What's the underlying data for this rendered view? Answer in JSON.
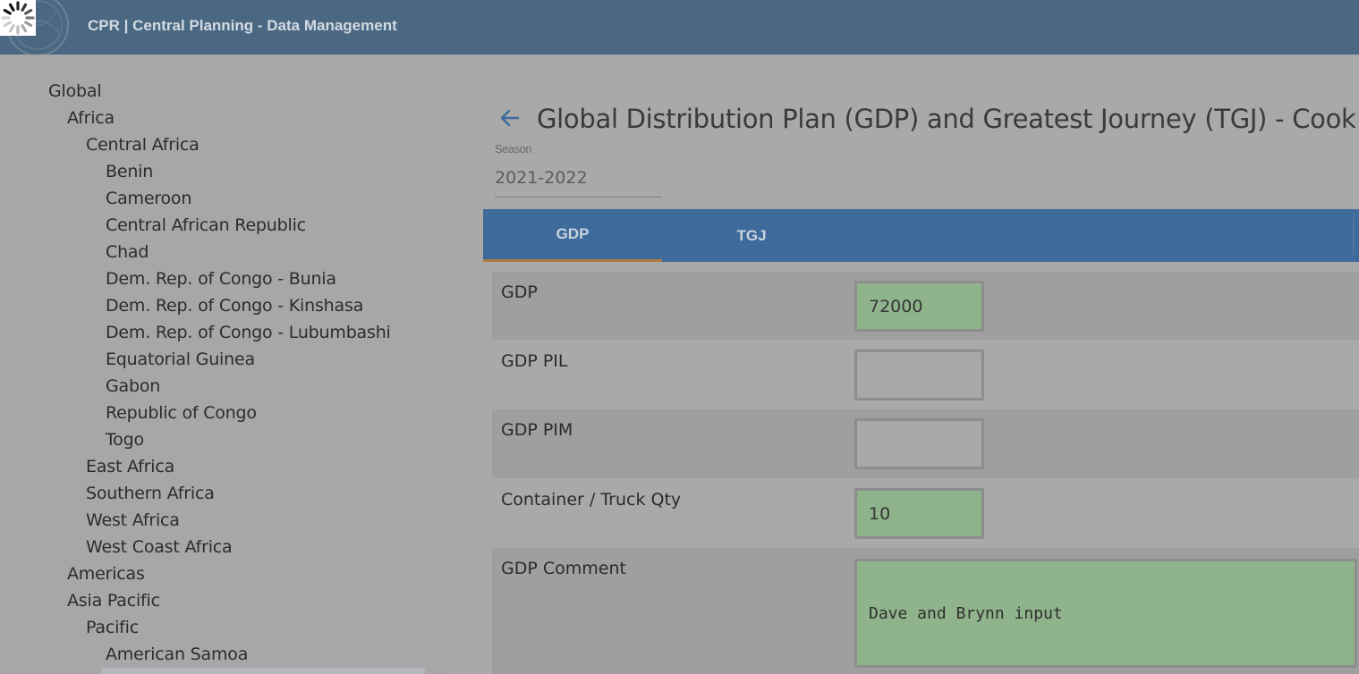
{
  "header": {
    "title": "CPR | Central Planning - Data Management"
  },
  "sidebar": {
    "items": [
      {
        "label": "Global",
        "level": 0
      },
      {
        "label": "Africa",
        "level": 1
      },
      {
        "label": "Central Africa",
        "level": 2
      },
      {
        "label": "Benin",
        "level": 3
      },
      {
        "label": "Cameroon",
        "level": 3
      },
      {
        "label": "Central African Republic",
        "level": 3
      },
      {
        "label": "Chad",
        "level": 3
      },
      {
        "label": "Dem. Rep. of Congo - Bunia",
        "level": 3
      },
      {
        "label": "Dem. Rep. of Congo - Kinshasa",
        "level": 3
      },
      {
        "label": "Dem. Rep. of Congo - Lubumbashi",
        "level": 3
      },
      {
        "label": "Equatorial Guinea",
        "level": 3
      },
      {
        "label": "Gabon",
        "level": 3
      },
      {
        "label": "Republic of Congo",
        "level": 3
      },
      {
        "label": "Togo",
        "level": 3
      },
      {
        "label": "East Africa",
        "level": 2
      },
      {
        "label": "Southern Africa",
        "level": 2
      },
      {
        "label": "West Africa",
        "level": 2
      },
      {
        "label": "West Coast Africa",
        "level": 2
      },
      {
        "label": "Americas",
        "level": 1
      },
      {
        "label": "Asia Pacific",
        "level": 1
      },
      {
        "label": "Pacific",
        "level": 2
      },
      {
        "label": "American Samoa",
        "level": 3
      }
    ]
  },
  "main": {
    "title": "Global Distribution Plan (GDP) and Greatest Journey (TGJ) - Cook Islan",
    "season": {
      "label": "Season",
      "value": "2021-2022"
    },
    "tabs": [
      {
        "label": "GDP",
        "active": true
      },
      {
        "label": "TGJ",
        "active": false
      }
    ],
    "fields": [
      {
        "label": "GDP",
        "value": "72000",
        "filled": true
      },
      {
        "label": "GDP PIL",
        "value": "",
        "filled": false
      },
      {
        "label": "GDP PIM",
        "value": "",
        "filled": false
      },
      {
        "label": "Container / Truck Qty",
        "value": "10",
        "filled": true
      }
    ],
    "comment": {
      "label": "GDP Comment",
      "value": "Dave and Brynn input"
    }
  },
  "colors": {
    "header_bg": "#4a6882",
    "tab_bar": "#3e6b9b",
    "tab_active_underline": "#b07a44",
    "filled_field": "#8fb38b",
    "back_arrow": "#3e6b9b"
  },
  "icons": {
    "spinner": "loading-spinner-icon",
    "back": "arrow-left-icon"
  }
}
